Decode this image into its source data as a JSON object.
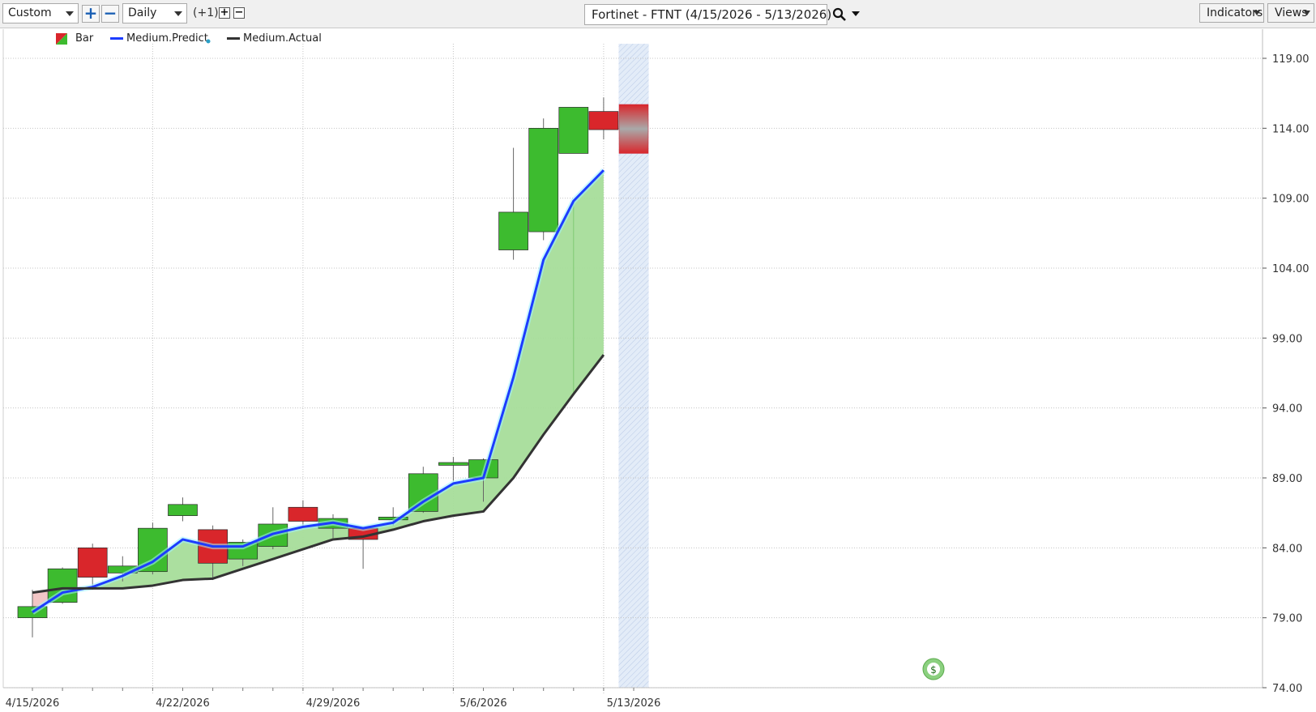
{
  "toolbar": {
    "period_select": "Custom",
    "interval_select": "Daily",
    "offset_label": "(+1)",
    "title": "Fortinet - FTNT (4/15/2026 - 5/13/2026)",
    "indicators_label": "Indicators",
    "views_label": "Views"
  },
  "legend": {
    "bar": "Bar",
    "predict": "Medium.Predict",
    "actual": "Medium.Actual"
  },
  "colors": {
    "up": "#3dbb2f",
    "down": "#d9262b",
    "predict": "#1c3cff",
    "actual": "#333333",
    "fill_green": "#a6dd9a",
    "fill_pink": "#f2c6c6",
    "forecast_zone": "#e3ecf8"
  },
  "chart_data": {
    "type": "candlestick",
    "title": "Fortinet - FTNT (4/15/2026 - 5/13/2026)",
    "ylim": [
      74,
      120
    ],
    "y_ticks": [
      "119.00",
      "114.00",
      "109.00",
      "104.00",
      "99.00",
      "94.00",
      "89.00",
      "84.00",
      "79.00",
      "74.00"
    ],
    "x_tick_labels": [
      "4/15/2026",
      "4/22/2026",
      "4/29/2026",
      "5/6/2026",
      "5/13/2026"
    ],
    "dates": [
      "4/15/2026",
      "4/16/2026",
      "4/17/2026",
      "4/20/2026",
      "4/21/2026",
      "4/22/2026",
      "4/23/2026",
      "4/24/2026",
      "4/27/2026",
      "4/28/2026",
      "4/29/2026",
      "4/30/2026",
      "5/1/2026",
      "5/4/2026",
      "5/5/2026",
      "5/6/2026",
      "5/7/2026",
      "5/8/2026",
      "5/11/2026",
      "5/12/2026",
      "5/13/2026"
    ],
    "candles": [
      {
        "o": 79.0,
        "h": 81.0,
        "l": 77.6,
        "c": 79.8
      },
      {
        "o": 80.1,
        "h": 82.6,
        "l": 80.0,
        "c": 82.5
      },
      {
        "o": 84.0,
        "h": 84.3,
        "l": 81.0,
        "c": 81.9
      },
      {
        "o": 82.2,
        "h": 83.4,
        "l": 81.6,
        "c": 82.7
      },
      {
        "o": 82.3,
        "h": 85.8,
        "l": 82.1,
        "c": 85.4
      },
      {
        "o": 86.3,
        "h": 87.6,
        "l": 85.9,
        "c": 87.1
      },
      {
        "o": 85.3,
        "h": 85.6,
        "l": 81.7,
        "c": 82.9
      },
      {
        "o": 83.2,
        "h": 84.6,
        "l": 82.7,
        "c": 84.4
      },
      {
        "o": 84.1,
        "h": 86.9,
        "l": 83.9,
        "c": 85.7
      },
      {
        "o": 86.9,
        "h": 87.4,
        "l": 85.6,
        "c": 85.9
      },
      {
        "o": 85.4,
        "h": 86.4,
        "l": 84.7,
        "c": 86.1
      },
      {
        "o": 85.4,
        "h": 85.4,
        "l": 82.5,
        "c": 84.6
      },
      {
        "o": 86.0,
        "h": 86.9,
        "l": 85.6,
        "c": 86.2
      },
      {
        "o": 86.6,
        "h": 89.8,
        "l": 86.5,
        "c": 89.3
      },
      {
        "o": 89.9,
        "h": 90.5,
        "l": 88.8,
        "c": 90.1
      },
      {
        "o": 89.0,
        "h": 90.4,
        "l": 87.3,
        "c": 90.3
      },
      {
        "o": 105.3,
        "h": 112.6,
        "l": 104.6,
        "c": 108.0
      },
      {
        "o": 106.6,
        "h": 114.7,
        "l": 106.0,
        "c": 114.0
      },
      {
        "o": 112.2,
        "h": 115.5,
        "l": 112.2,
        "c": 115.5
      },
      {
        "o": 115.2,
        "h": 116.2,
        "l": 113.2,
        "c": 113.9
      },
      {
        "o": 115.7,
        "h": 115.7,
        "l": 112.2,
        "c": 112.2
      }
    ],
    "series": [
      {
        "name": "Medium.Predict",
        "values": [
          79.4,
          80.8,
          81.2,
          82.0,
          83.0,
          84.6,
          84.1,
          84.1,
          85.0,
          85.5,
          85.8,
          85.4,
          85.8,
          87.3,
          88.6,
          89.0,
          96.2,
          104.6,
          108.8,
          111.0
        ]
      },
      {
        "name": "Medium.Actual",
        "values": [
          80.8,
          81.1,
          81.1,
          81.1,
          81.3,
          81.7,
          81.8,
          82.5,
          83.2,
          83.9,
          84.6,
          84.8,
          85.3,
          85.9,
          86.3,
          86.6,
          89.0,
          92.1,
          95.0,
          97.8
        ]
      }
    ],
    "legend_position": "top-left",
    "grid": true,
    "forecast_zone": {
      "from_index": 20,
      "to_index": 20
    }
  }
}
